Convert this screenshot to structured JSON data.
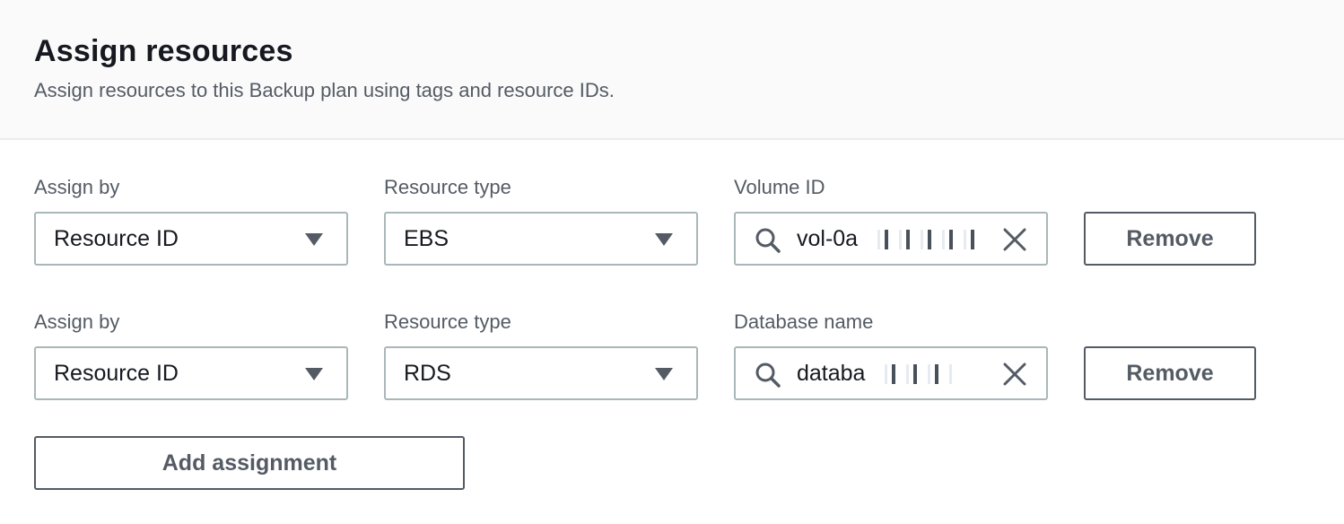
{
  "header": {
    "title": "Assign resources",
    "description": "Assign resources to this Backup plan using tags and resource IDs."
  },
  "assignments": [
    {
      "assign_by_label": "Assign by",
      "assign_by_value": "Resource ID",
      "resource_type_label": "Resource type",
      "resource_type_value": "EBS",
      "id_label": "Volume ID",
      "id_value": "vol-0a",
      "remove_label": "Remove"
    },
    {
      "assign_by_label": "Assign by",
      "assign_by_value": "Resource ID",
      "resource_type_label": "Resource type",
      "resource_type_value": "RDS",
      "id_label": "Database name",
      "id_value": "databa",
      "remove_label": "Remove"
    }
  ],
  "add_assignment_label": "Add assignment",
  "icons": {
    "search": "search-icon",
    "clear": "close-icon",
    "caret": "caret-down-icon"
  },
  "colors": {
    "border": "#aab7b8",
    "button_border": "#545b64",
    "header_bg": "#fafafa",
    "text": "#16191f",
    "muted_text": "#545b64"
  }
}
